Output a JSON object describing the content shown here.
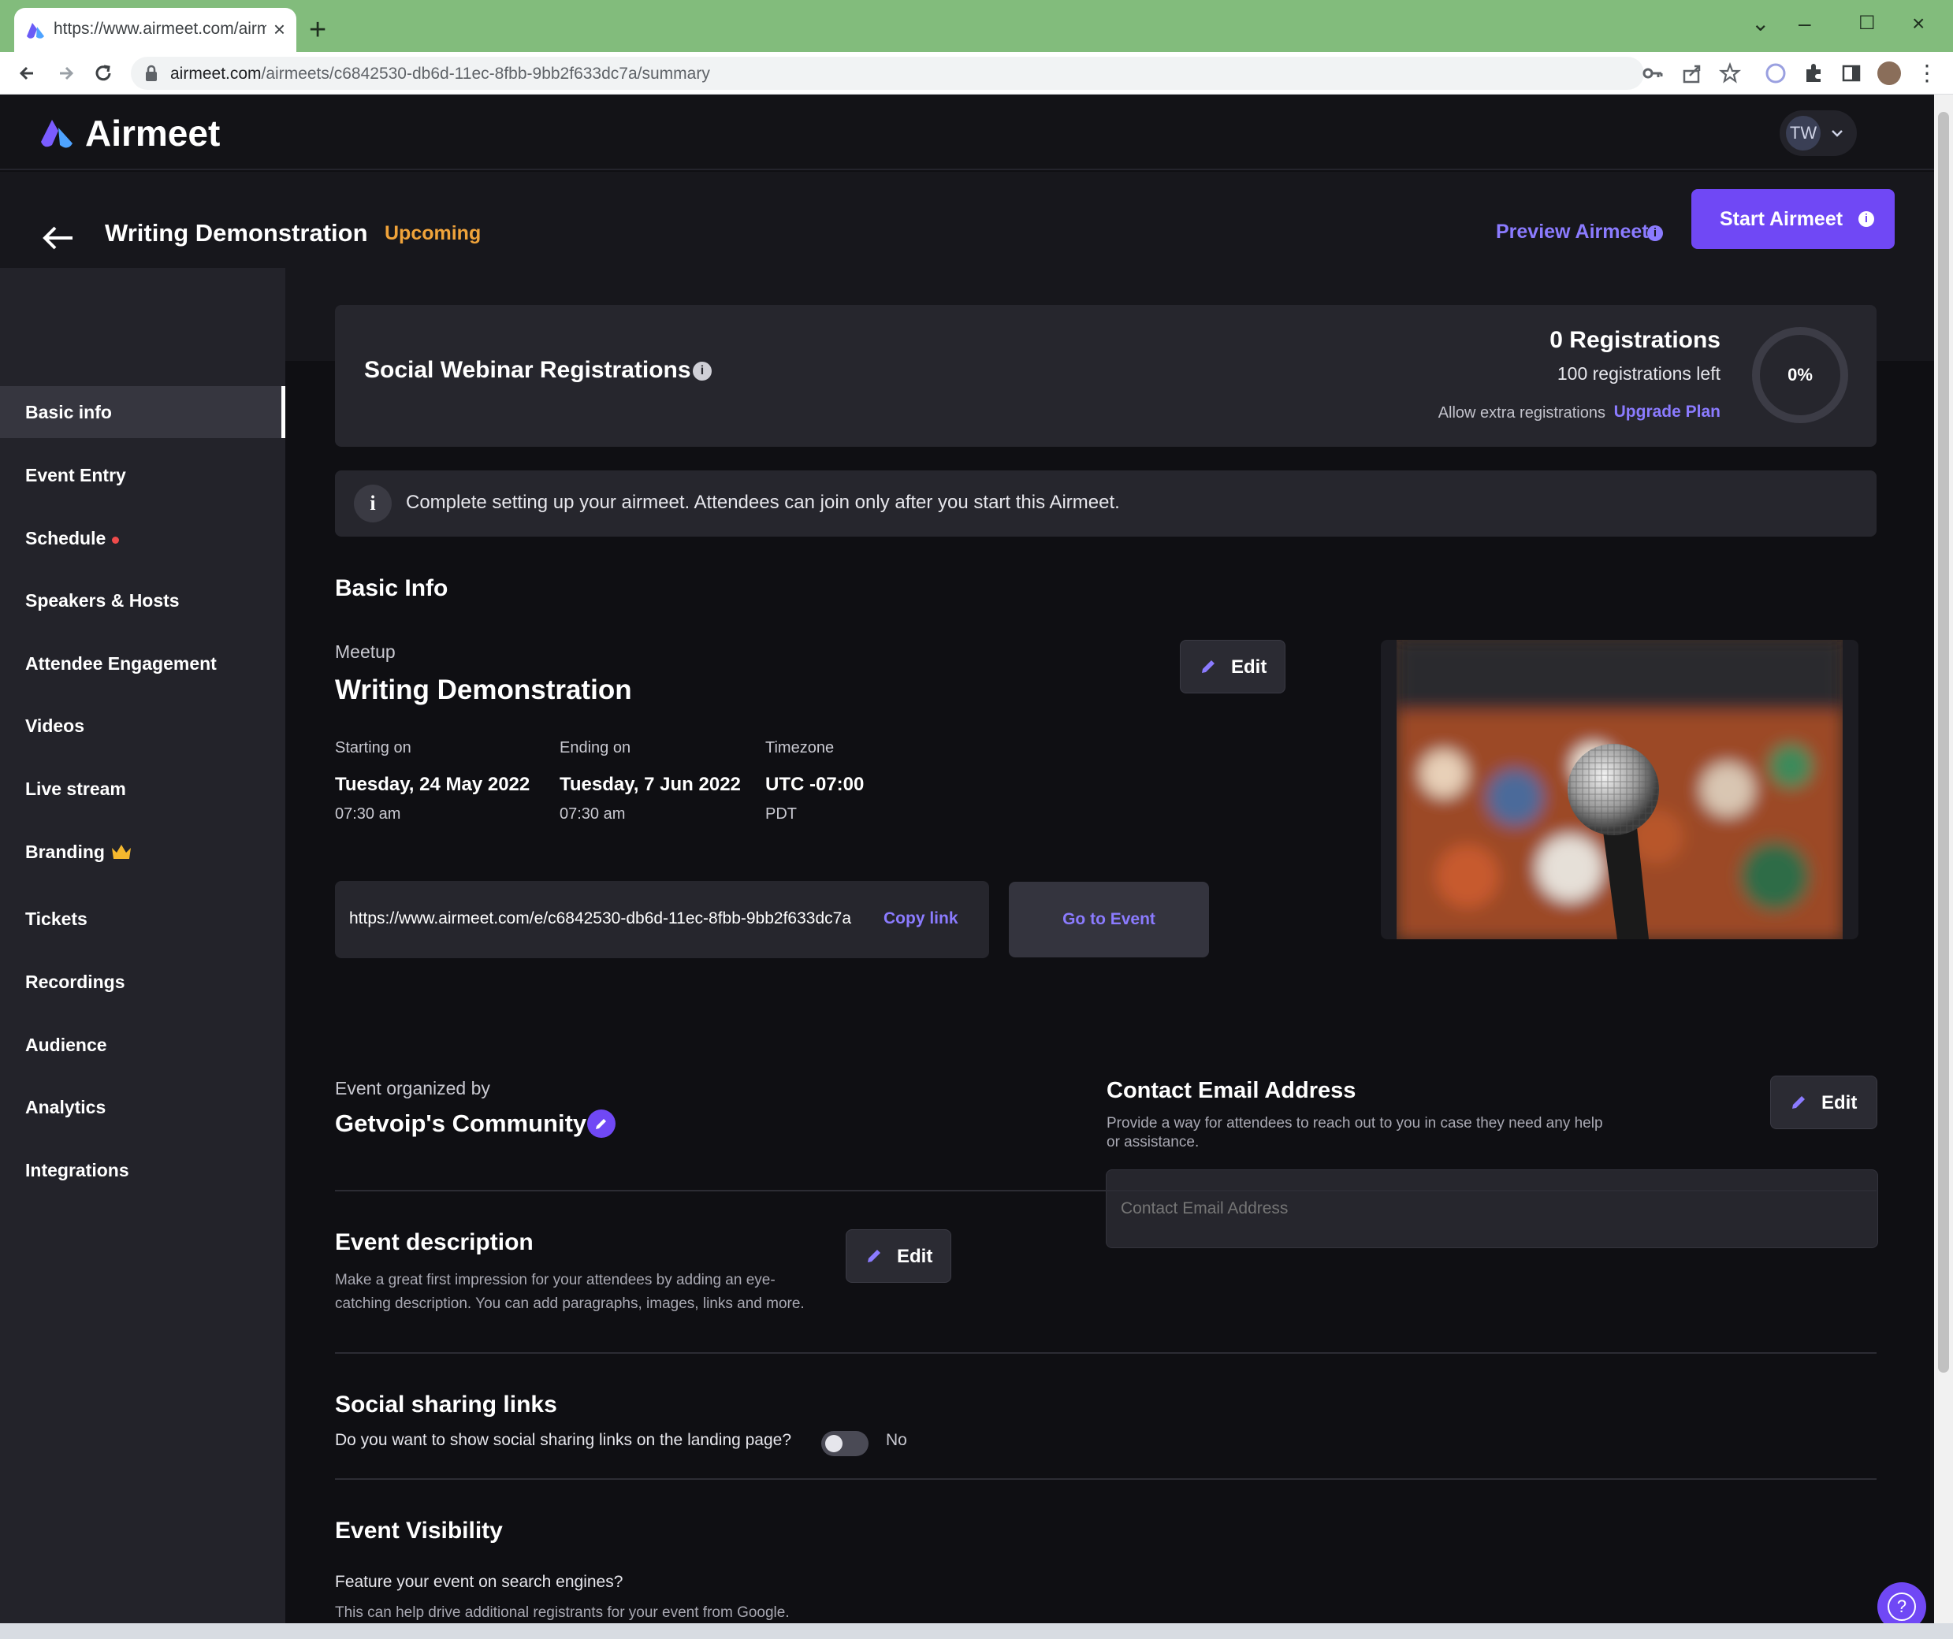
{
  "browser": {
    "tab_title": "https://www.airmeet.com/airmee",
    "url_host": "airmeet.com",
    "url_path": "/airmeets/c6842530-db6d-11ec-8fbb-9bb2f633dc7a/summary"
  },
  "app": {
    "brand": "Airmeet",
    "user_initials": "TW",
    "event_title": "Writing Demonstration",
    "event_status": "Upcoming",
    "preview_label": "Preview Airmeet",
    "start_label": "Start Airmeet",
    "info_glyph": "i"
  },
  "sidebar": {
    "items": [
      {
        "label": "Basic info",
        "active": true
      },
      {
        "label": "Event Entry"
      },
      {
        "label": "Schedule"
      },
      {
        "label": "Speakers & Hosts"
      },
      {
        "label": "Attendee Engagement"
      },
      {
        "label": "Videos"
      },
      {
        "label": "Live stream"
      },
      {
        "label": "Branding"
      },
      {
        "label": "Tickets"
      },
      {
        "label": "Recordings"
      },
      {
        "label": "Audience"
      },
      {
        "label": "Analytics"
      },
      {
        "label": "Integrations"
      }
    ]
  },
  "registrations": {
    "title": "Social Webinar Registrations",
    "count": "0 Registrations",
    "left": "100 registrations left",
    "extra_label": "Allow extra registrations",
    "upgrade_label": "Upgrade Plan",
    "percent": "0%",
    "progress_fraction": 0
  },
  "notice": {
    "text": "Complete setting up your airmeet. Attendees can join only after you start this Airmeet."
  },
  "basic_info": {
    "heading": "Basic Info",
    "type": "Meetup",
    "name": "Writing Demonstration",
    "edit_label": "Edit",
    "start_label": "Starting on",
    "start_date": "Tuesday, 24 May 2022",
    "start_time": "07:30 am",
    "end_label": "Ending on",
    "end_date": "Tuesday, 7 Jun 2022",
    "end_time": "07:30 am",
    "tz_label": "Timezone",
    "tz_value": "UTC -07:00",
    "tz_abbr": "PDT",
    "event_link": "https://www.airmeet.com/e/c6842530-db6d-11ec-8fbb-9bb2f633dc7a",
    "copy_label": "Copy link",
    "go_label": "Go to Event"
  },
  "organizer": {
    "label": "Event organized by",
    "name": "Getvoip's Community"
  },
  "contact": {
    "heading": "Contact Email Address",
    "desc": "Provide a way for attendees to reach out to you in case they need any help or assistance.",
    "placeholder": "Contact Email Address",
    "edit_label": "Edit"
  },
  "description": {
    "heading": "Event description",
    "text": "Make a great first impression for your attendees by adding an eye-catching description. You can add paragraphs, images, links and more.",
    "edit_label": "Edit"
  },
  "social": {
    "heading": "Social sharing links",
    "question": "Do you want to show social sharing links on the landing page?",
    "toggle_value": "No"
  },
  "visibility": {
    "heading": "Event Visibility",
    "question": "Feature your event on search engines?",
    "note": "This can help drive additional registrants for your event from Google."
  },
  "help_glyph": "?",
  "colors": {
    "accent": "#7048f5",
    "link": "#8b7bff",
    "status": "#f0a33a",
    "background": "#0f0f13"
  }
}
